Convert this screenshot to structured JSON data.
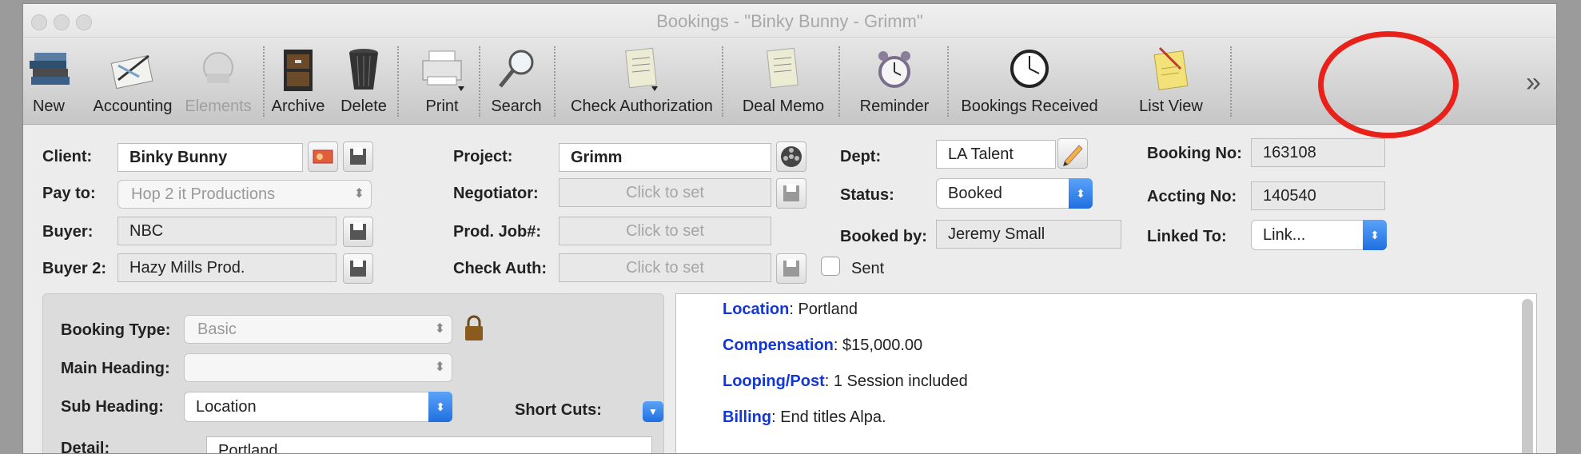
{
  "window": {
    "title": "Bookings - \"Binky Bunny - Grimm\""
  },
  "toolbar": {
    "new": "New",
    "accounting": "Accounting",
    "elements": "Elements",
    "archive": "Archive",
    "delete": "Delete",
    "print": "Print",
    "search": "Search",
    "check_authorization": "Check Authorization",
    "deal_memo": "Deal Memo",
    "reminder": "Reminder",
    "bookings_received": "Bookings Received",
    "list_view": "List View",
    "overflow": "»"
  },
  "form": {
    "client": {
      "label": "Client:",
      "value": "Binky Bunny"
    },
    "pay_to": {
      "label": "Pay to:",
      "value": "Hop 2 it Productions"
    },
    "buyer": {
      "label": "Buyer:",
      "value": "NBC"
    },
    "buyer2": {
      "label": "Buyer 2:",
      "value": "Hazy Mills Prod."
    },
    "project": {
      "label": "Project:",
      "value": "Grimm"
    },
    "negotiator": {
      "label": "Negotiator:",
      "placeholder": "Click to set"
    },
    "prod_job": {
      "label": "Prod. Job#:",
      "placeholder": "Click to set"
    },
    "check_auth": {
      "label": "Check Auth:",
      "placeholder": "Click to set"
    },
    "sent": {
      "label": "Sent",
      "checked": false
    },
    "dept": {
      "label": "Dept:",
      "value": "LA Talent"
    },
    "status": {
      "label": "Status:",
      "value": "Booked"
    },
    "booked_by": {
      "label": "Booked by:",
      "value": "Jeremy Small"
    },
    "booking_no": {
      "label": "Booking No:",
      "value": "163108"
    },
    "accting_no": {
      "label": "Accting No:",
      "value": "140540"
    },
    "linked_to": {
      "label": "Linked To:",
      "value": "Link..."
    }
  },
  "details": {
    "booking_type": {
      "label": "Booking Type:",
      "value": "Basic"
    },
    "main_heading": {
      "label": "Main Heading:",
      "value": ""
    },
    "sub_heading": {
      "label": "Sub Heading:",
      "value": "Location"
    },
    "short_cuts": {
      "label": "Short Cuts:"
    },
    "detail": {
      "label": "Detail:",
      "value": "Portland"
    }
  },
  "notes": [
    {
      "key": "Location",
      "value": ": Portland"
    },
    {
      "key": "Compensation",
      "value": ": $15,000.00"
    },
    {
      "key": "Looping/Post",
      "value": ": 1 Session included"
    },
    {
      "key": "Billing",
      "value": ": End titles Alpa."
    }
  ],
  "colors": {
    "annotation_circle": "#e8221b",
    "note_key": "#1336d6",
    "select_accent": "#1f6fe0"
  }
}
